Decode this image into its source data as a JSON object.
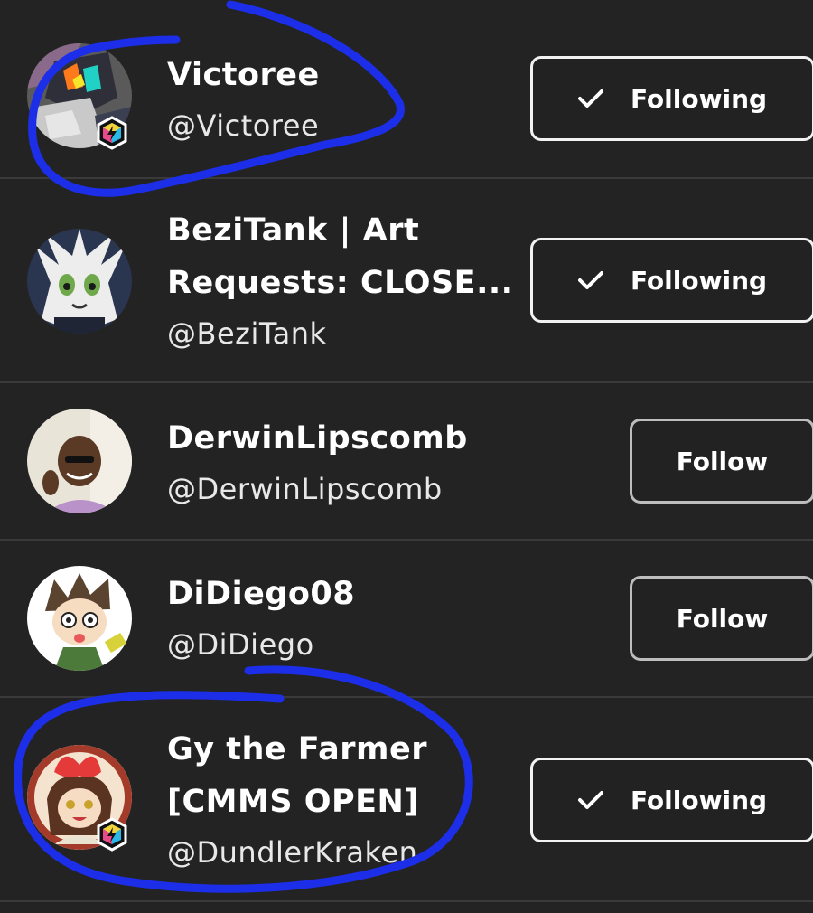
{
  "users": [
    {
      "display_name": "Victoree",
      "handle": "@Victoree",
      "button_label": "Following",
      "button_state": "following",
      "badge": true
    },
    {
      "display_name": "BeziTank | Art Requests: CLOSE...",
      "handle": "@BeziTank",
      "button_label": "Following",
      "button_state": "following",
      "badge": false
    },
    {
      "display_name": "DerwinLipscomb",
      "handle": "@DerwinLipscomb",
      "button_label": "Follow",
      "button_state": "follow",
      "badge": false
    },
    {
      "display_name": "DiDiego08",
      "handle": "@DiDiego",
      "button_label": "Follow",
      "button_state": "follow",
      "badge": false
    },
    {
      "display_name": "Gy the Farmer [CMMS OPEN]",
      "handle": "@DundlerKraken",
      "button_label": "Following",
      "button_state": "following",
      "badge": true
    }
  ],
  "colors": {
    "background": "#232323",
    "divider": "#3a3a3a",
    "annotation": "#1d2ee8"
  },
  "icons": {
    "following_button": "checkmark-icon",
    "badge": "premium-hexagon-icon"
  }
}
